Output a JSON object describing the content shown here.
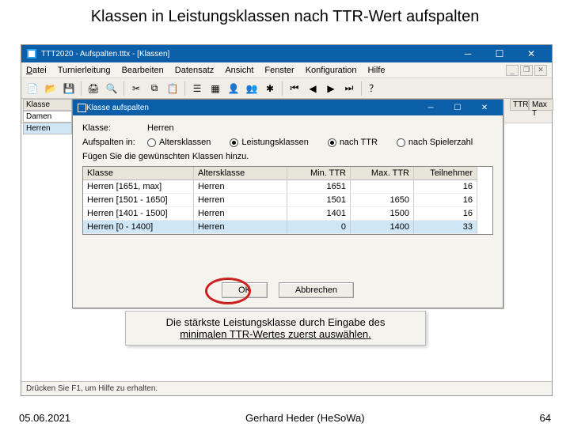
{
  "slide": {
    "title": "Klassen in Leistungsklassen nach TTR-Wert aufspalten",
    "caption_line1": "Die stärkste Leistungsklasse durch Eingabe des",
    "caption_line2": "minimalen TTR-Wertes zuerst auswählen.",
    "date": "05.06.2021",
    "author": "Gerhard Heder (HeSoWa)",
    "page": "64"
  },
  "app": {
    "title": "TTT2020 - Aufspalten.tttx - [Klassen]",
    "menu": {
      "datei": "Datei",
      "turnier": "Turnierleitung",
      "bearb": "Bearbeiten",
      "daten": "Datensatz",
      "ansicht": "Ansicht",
      "fenster": "Fenster",
      "konfig": "Konfiguration",
      "hilfe": "Hilfe"
    },
    "status": "Drücken Sie F1, um Hilfe zu erhalten."
  },
  "bg": {
    "h_klasse": "Klasse",
    "h_ttr": "TTR",
    "h_max": "Max T",
    "r_damen": "Damen",
    "r_herren": "Herren"
  },
  "dialog": {
    "title": "Klasse aufspalten",
    "lbl_klasse": "Klasse:",
    "val_klasse": "Herren",
    "lbl_split": "Aufspalten in:",
    "opt_alters": "Altersklassen",
    "opt_leistung": "Leistungsklassen",
    "opt_ttr": "nach TTR",
    "opt_spiel": "nach Spielerzahl",
    "hint": "Fügen Sie die gewünschten Klassen hinzu.",
    "cols": {
      "klasse": "Klasse",
      "alters": "Altersklasse",
      "min": "Min. TTR",
      "max": "Max. TTR",
      "teil": "Teilnehmer"
    },
    "rows": [
      {
        "k": "Herren [1651, max]",
        "a": "Herren",
        "min": "1651",
        "max": "",
        "t": "16"
      },
      {
        "k": "Herren [1501 - 1650]",
        "a": "Herren",
        "min": "1501",
        "max": "1650",
        "t": "16"
      },
      {
        "k": "Herren [1401 - 1500]",
        "a": "Herren",
        "min": "1401",
        "max": "1500",
        "t": "16"
      },
      {
        "k": "Herren [0 - 1400]",
        "a": "Herren",
        "min": "0",
        "max": "1400",
        "t": "33"
      }
    ],
    "ok": "OK",
    "cancel": "Abbrechen"
  }
}
